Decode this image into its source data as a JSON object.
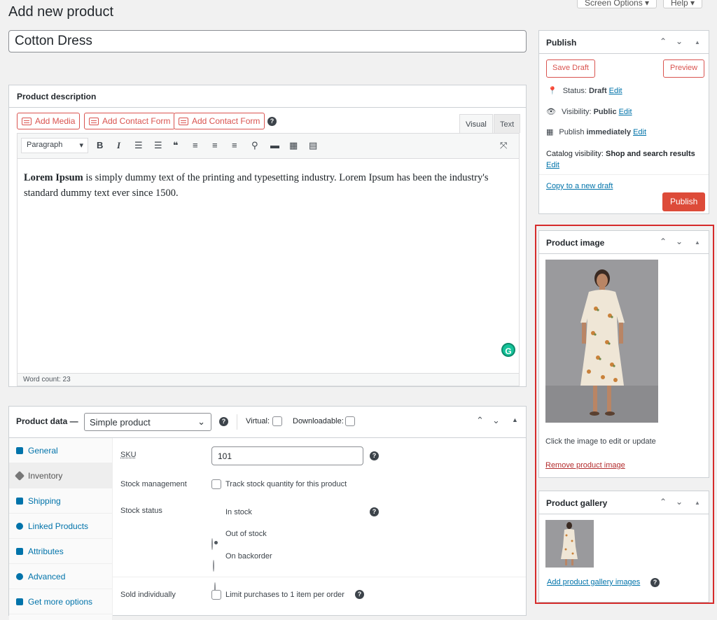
{
  "page": {
    "title": "Add new product",
    "screen_options": "Screen Options ▾",
    "help": "Help ▾"
  },
  "product_title": "Cotton Dress",
  "description": {
    "heading": "Product description",
    "add_media": "Add Media",
    "add_contact_form_1": "Add Contact Form",
    "add_contact_form_2": "Add Contact Form",
    "tab_visual": "Visual",
    "tab_text": "Text",
    "paragraph": "Paragraph",
    "content_bold": "Lorem Ipsum",
    "content_rest": " is simply dummy text of the printing and typesetting industry. Lorem Ipsum has been the industry's standard dummy text ever since 1500.",
    "word_count": "Word count: 23"
  },
  "product_data": {
    "label": "Product data —",
    "type": "Simple product",
    "virtual": "Virtual:",
    "downloadable": "Downloadable:",
    "tabs": [
      {
        "label": "General"
      },
      {
        "label": "Inventory"
      },
      {
        "label": "Shipping"
      },
      {
        "label": "Linked Products"
      },
      {
        "label": "Attributes"
      },
      {
        "label": "Advanced"
      },
      {
        "label": "Get more options"
      }
    ],
    "sku_label": "SKU",
    "sku_value": "101",
    "stock_mgmt_label": "Stock management",
    "stock_mgmt_text": "Track stock quantity for this product",
    "stock_status_label": "Stock status",
    "stock_options": [
      "In stock",
      "Out of stock",
      "On backorder"
    ],
    "sold_individually_label": "Sold individually",
    "sold_individually_text": "Limit purchases to 1 item per order"
  },
  "publish": {
    "heading": "Publish",
    "save_draft": "Save Draft",
    "preview": "Preview",
    "status_label": "Status:",
    "status_value": "Draft",
    "visibility_label": "Visibility:",
    "visibility_value": "Public",
    "publish_label": "Publish",
    "publish_value": "immediately",
    "edit": "Edit",
    "catalog_label": "Catalog visibility:",
    "catalog_value": "Shop and search results",
    "copy_draft": "Copy to a new draft",
    "publish_button": "Publish"
  },
  "product_image": {
    "heading": "Product image",
    "hint": "Click the image to edit or update",
    "remove": "Remove product image"
  },
  "product_gallery": {
    "heading": "Product gallery",
    "add": "Add product gallery images"
  },
  "colors": {
    "accent_red": "#d9534f",
    "publish_red": "#dd4b39",
    "link_blue": "#0073aa",
    "highlight_frame": "#d62b2b"
  }
}
